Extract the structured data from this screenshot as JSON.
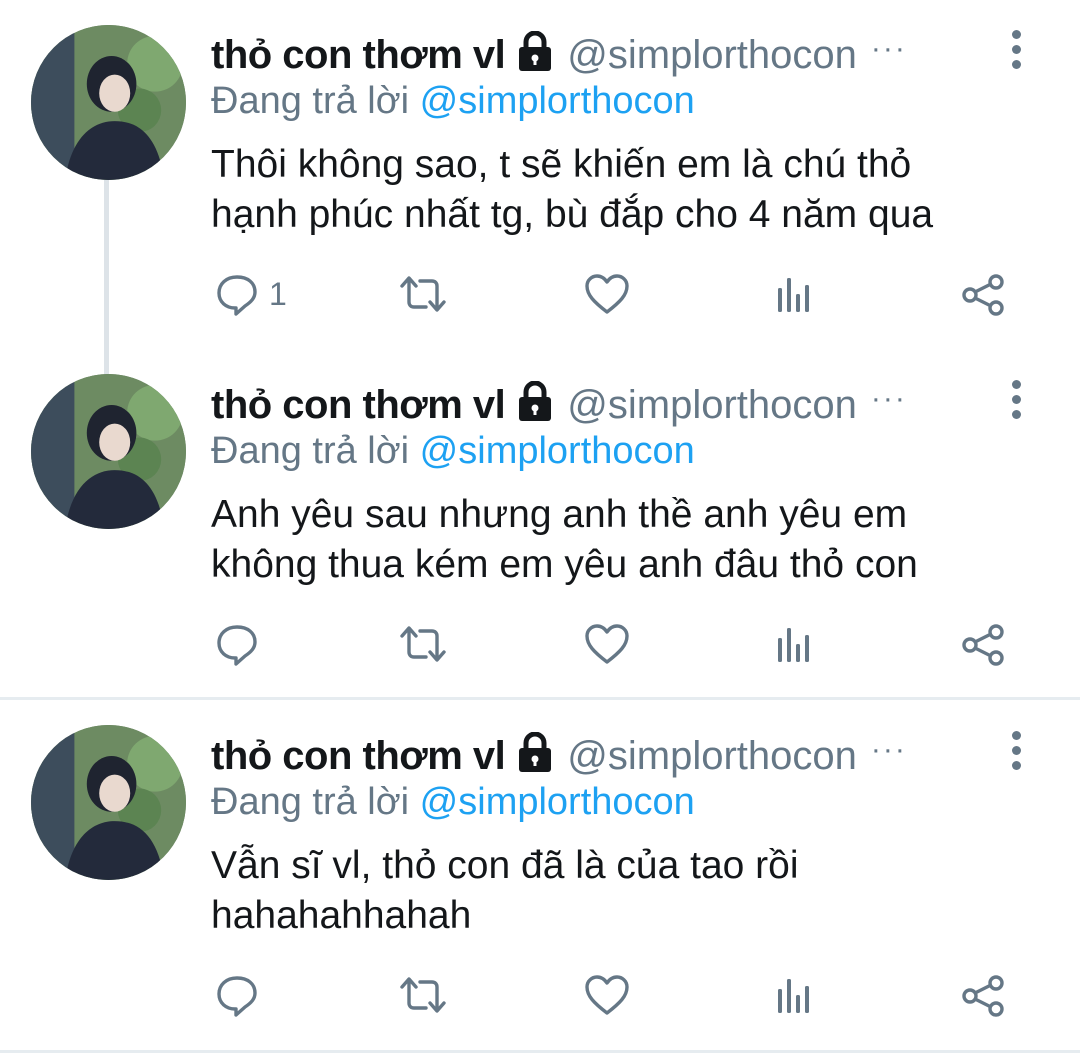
{
  "colors": {
    "text": "#14171a",
    "secondary": "#657786",
    "link": "#1da1f2",
    "divider": "#e6ecf0"
  },
  "tweets": [
    {
      "name": "thỏ con thơm vl",
      "handle": "@simplorthocon",
      "more": "···",
      "reply_prefix": "Đang trả lời",
      "reply_to": "@simplorthocon",
      "lines": [
        "Thôi không sao, t sẽ khiến em là chú thỏ",
        "hạnh phúc nhất tg, bù đắp cho 4 năm qua"
      ],
      "reply_count": "1"
    },
    {
      "name": "thỏ con thơm vl",
      "handle": "@simplorthocon",
      "more": "···",
      "reply_prefix": "Đang trả lời",
      "reply_to": "@simplorthocon",
      "lines": [
        "Anh yêu sau nhưng anh thề anh yêu em",
        "không thua kém em yêu anh đâu thỏ con"
      ],
      "reply_count": ""
    },
    {
      "name": "thỏ con thơm vl",
      "handle": "@simplorthocon",
      "more": "···",
      "reply_prefix": "Đang trả lời",
      "reply_to": "@simplorthocon",
      "lines": [
        "Vẫn sĩ vl, thỏ con đã là của tao rồi",
        "hahahahhahah"
      ],
      "reply_count": ""
    }
  ],
  "icons": {
    "avatar": "user-avatar-photo",
    "lock": "lock-icon",
    "menu": "vertical-dots-menu-icon",
    "reply": "reply-bubble-icon",
    "retweet": "retweet-icon",
    "like": "heart-icon",
    "stats": "analytics-bars-icon",
    "share": "share-icon"
  }
}
